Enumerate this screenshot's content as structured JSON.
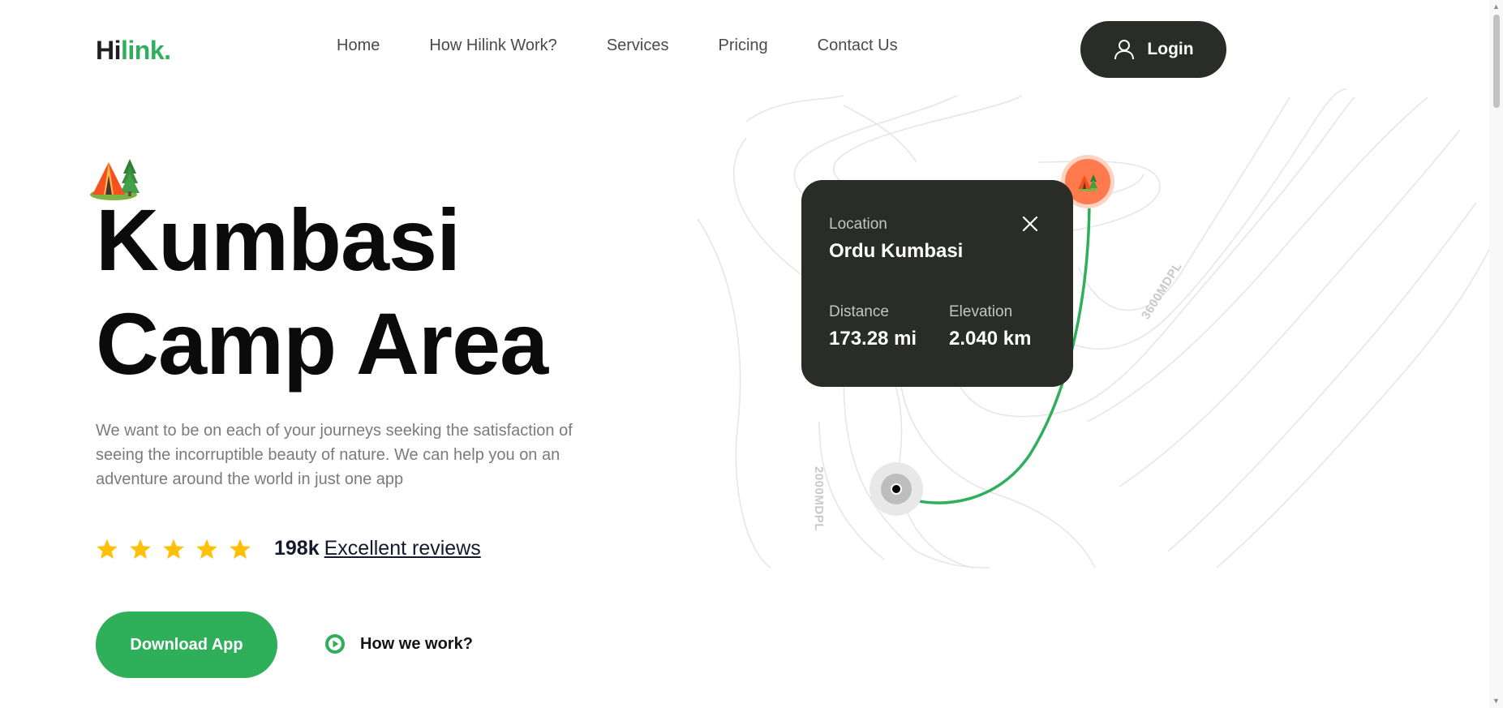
{
  "header": {
    "logo_dark": "Hi",
    "logo_green": "link.",
    "nav": [
      "Home",
      "How Hilink Work?",
      "Services",
      "Pricing",
      "Contact Us"
    ],
    "login_label": "Login"
  },
  "hero": {
    "title_line1": "Kumbasi",
    "title_line2": "Camp Area",
    "description": "We want to be on each of your journeys seeking the satisfaction of seeing the incorruptible beauty of nature. We can help you on an adventure around the world in just one app",
    "rating_stars": 5,
    "review_count": "198k",
    "review_link": "Excellent reviews",
    "download_label": "Download App",
    "how_work_label": "How we work?"
  },
  "location_card": {
    "location_label": "Location",
    "location_value": "Ordu Kumbasi",
    "distance_label": "Distance",
    "distance_value": "173.28 mi",
    "elevation_label": "Elevation",
    "elevation_value": "2.040 km"
  },
  "map": {
    "contour_label_1": "3600MDPL",
    "contour_label_2": "2000MDPL"
  },
  "colors": {
    "brand_green": "#30af5b",
    "dark": "#292c27",
    "pin_orange": "#ff7a4d",
    "star_yellow": "#ffc107"
  },
  "icons": {
    "login": "user-icon",
    "close": "close-icon",
    "play": "play-icon",
    "star": "star-icon",
    "tent": "tent-icon"
  }
}
